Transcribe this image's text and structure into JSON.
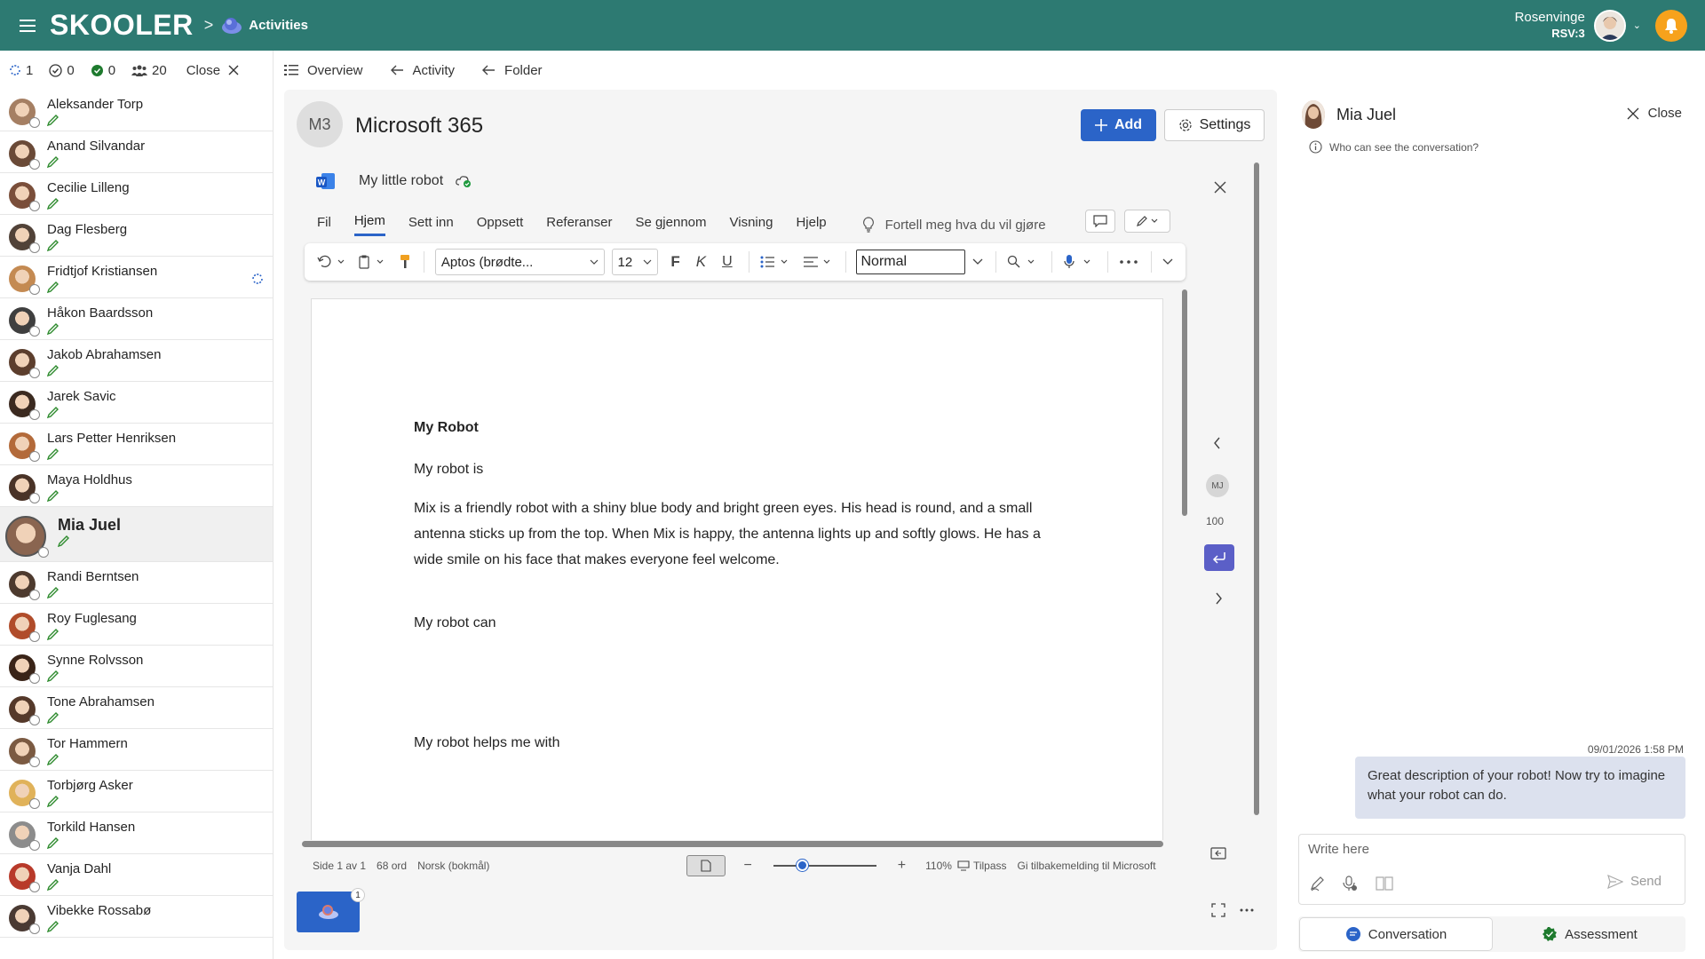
{
  "topbar": {
    "logo": "SKOOLER",
    "breadcrumb_sep": ">",
    "breadcrumb_current": "Activities",
    "user_name": "Rosenvinge",
    "user_code": "RSV:3"
  },
  "list_header": {
    "count_sync": "1",
    "count_done": "0",
    "count_assessed": "0",
    "count_students": "20",
    "close_label": "Close"
  },
  "students": [
    {
      "name": "Aleksander Torp",
      "color": "#a57f63"
    },
    {
      "name": "Anand Silvandar",
      "color": "#6a4a37"
    },
    {
      "name": "Cecilie Lilleng",
      "color": "#7a4e3a"
    },
    {
      "name": "Dag Flesberg",
      "color": "#514238"
    },
    {
      "name": "Fridtjof Kristiansen",
      "color": "#c48a52"
    },
    {
      "name": "Håkon Baardsson",
      "color": "#3f3f3f"
    },
    {
      "name": "Jakob Abrahamsen",
      "color": "#5c3e2d"
    },
    {
      "name": "Jarek Savic",
      "color": "#3b2a20"
    },
    {
      "name": "Lars Petter Henriksen",
      "color": "#b36a3a"
    },
    {
      "name": "Maya Holdhus",
      "color": "#4a3327"
    },
    {
      "name": "Mia Juel",
      "color": "#8a6550",
      "selected": true
    },
    {
      "name": "Randi Berntsen",
      "color": "#4d3a2e"
    },
    {
      "name": "Roy Fuglesang",
      "color": "#b04c2a"
    },
    {
      "name": "Synne Rolvsson",
      "color": "#3a2418"
    },
    {
      "name": "Tone Abrahamsen",
      "color": "#55392a"
    },
    {
      "name": "Tor Hammern",
      "color": "#7b5a42"
    },
    {
      "name": "Torbjørg Asker",
      "color": "#e0b25a"
    },
    {
      "name": "Torkild Hansen",
      "color": "#8c8c8c"
    },
    {
      "name": "Vanja Dahl",
      "color": "#b83a2a"
    },
    {
      "name": "Vibekke Rossabø",
      "color": "#4a3a33"
    }
  ],
  "tabs": {
    "overview": "Overview",
    "activity": "Activity",
    "folder": "Folder"
  },
  "main": {
    "badge": "M3",
    "title": "Microsoft 365",
    "add_label": "Add",
    "settings_label": "Settings"
  },
  "word": {
    "doc_name": "My little robot",
    "ribbon_tabs": [
      "Fil",
      "Hjem",
      "Sett inn",
      "Oppsett",
      "Referanser",
      "Se gjennom",
      "Visning",
      "Hjelp"
    ],
    "active_tab": "Hjem",
    "tellme": "Fortell meg hva du vil gjøre",
    "font": "Aptos (brødte...",
    "font_size": "12",
    "bold": "F",
    "italic": "K",
    "underline": "U",
    "style": "Normal",
    "status": {
      "page": "Side 1 av 1",
      "words": "68 ord",
      "lang": "Norsk (bokmål)",
      "zoom": "110%",
      "fit": "Tilpass",
      "feedback": "Gi tilbakemelding til Microsoft"
    }
  },
  "document": {
    "title": "My Robot",
    "p1": "My robot is",
    "p2": "Mix is a friendly robot with a shiny blue body and bright green eyes. His head is round, and a small antenna sticks up from the top. When Mix is happy, the antenna lights up and softly glows. He has a wide smile on his face that makes everyone feel welcome.",
    "p3": "My robot can",
    "p4": "My robot helps me with"
  },
  "rail": {
    "initials": "MJ",
    "score": "100"
  },
  "pin": {
    "badge": "1"
  },
  "conversation": {
    "name": "Mia Juel",
    "close_label": "Close",
    "who_label": "Who can see the conversation?",
    "timestamp": "09/01/2026 1:58 PM",
    "message": "Great description of your robot! Now try to imagine what your robot can do.",
    "compose_placeholder": "Write here",
    "send_label": "Send",
    "tab_conversation": "Conversation",
    "tab_assessment": "Assessment"
  },
  "colors": {
    "brand": "#2d7a72",
    "accent": "#2b64c8",
    "pen": "#2e8b2e"
  }
}
